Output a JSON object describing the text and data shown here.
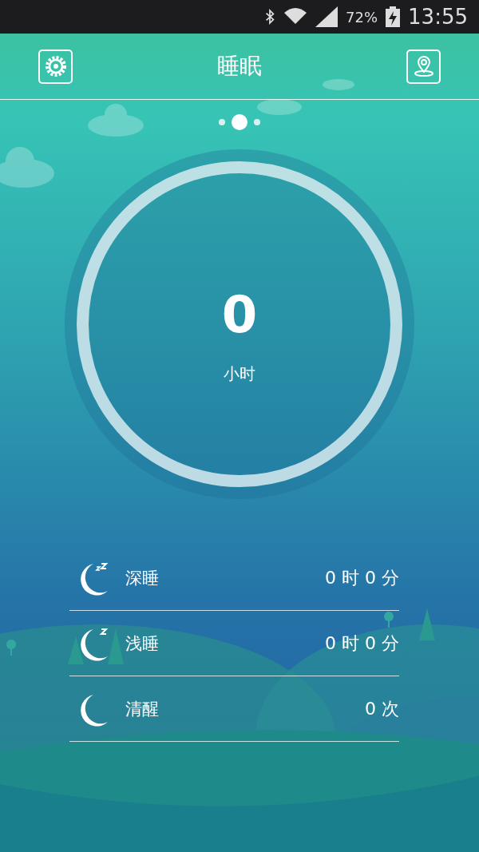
{
  "status_bar": {
    "battery": "72%",
    "time": "13:55"
  },
  "header": {
    "title": "睡眠"
  },
  "pages": [
    {
      "selected": false
    },
    {
      "selected": true
    },
    {
      "selected": false
    }
  ],
  "summary": {
    "value": "0",
    "unit": "小时"
  },
  "stats": [
    {
      "kind": "deep",
      "label": "深睡",
      "value": "0 时 0 分"
    },
    {
      "kind": "light",
      "label": "浅睡",
      "value": "0 时 0 分"
    },
    {
      "kind": "awake",
      "label": "清醒",
      "value": "0 次"
    }
  ]
}
